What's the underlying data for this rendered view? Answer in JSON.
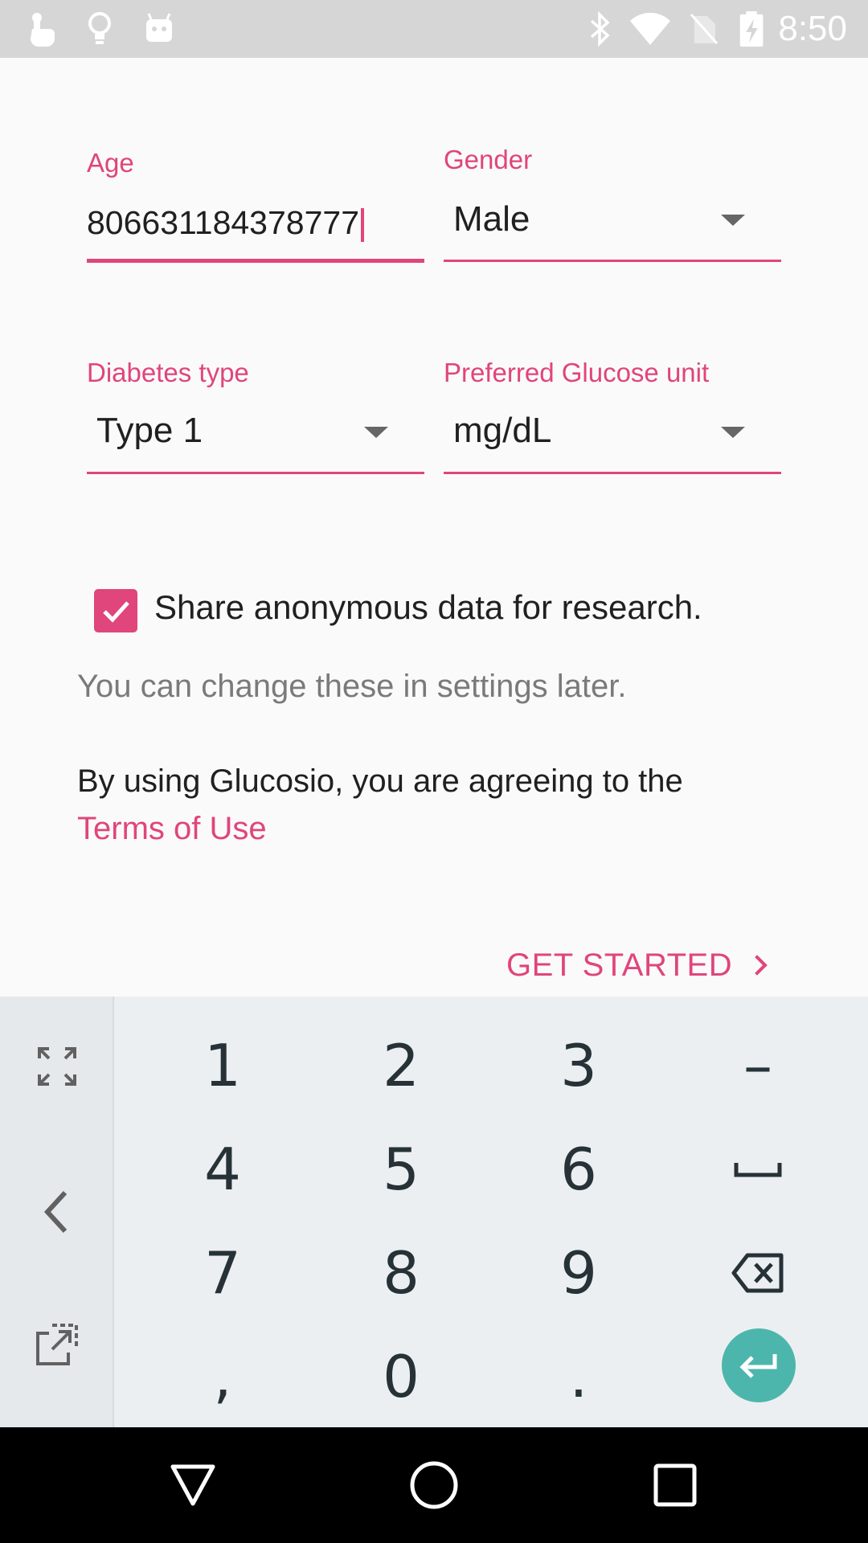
{
  "status_bar": {
    "time": "8:50",
    "left_icons": [
      "touch-icon",
      "lightbulb-icon",
      "android-icon"
    ],
    "right_icons": [
      "bluetooth-icon",
      "wifi-icon",
      "no-sim-icon",
      "battery-charging-icon"
    ]
  },
  "form": {
    "age": {
      "label": "Age",
      "value": "806631184378777"
    },
    "gender": {
      "label": "Gender",
      "value": "Male"
    },
    "diabetes_type": {
      "label": "Diabetes type",
      "value": "Type 1"
    },
    "glucose_unit": {
      "label": "Preferred Glucose unit",
      "value": "mg/dL"
    },
    "share_checkbox": {
      "label": "Share anonymous data for research.",
      "checked": true
    },
    "hint": "You can change these in settings later.",
    "terms_text": "By using Glucosio, you are agreeing to the",
    "terms_link": "Terms of Use",
    "get_started": "GET STARTED"
  },
  "keyboard": {
    "keys": [
      [
        "1",
        "2",
        "3",
        "–"
      ],
      [
        "4",
        "5",
        "6",
        "space"
      ],
      [
        "7",
        "8",
        "9",
        "backspace"
      ],
      [
        ",",
        "0",
        ".",
        "enter"
      ]
    ],
    "side_icons": [
      "fullscreen-icon",
      "back-arrow-icon",
      "popout-icon"
    ],
    "row1": {
      "k1": "1",
      "k2": "2",
      "k3": "3",
      "k4": "–"
    },
    "row2": {
      "k1": "4",
      "k2": "5",
      "k3": "6"
    },
    "row3": {
      "k1": "7",
      "k2": "8",
      "k3": "9"
    },
    "row4": {
      "k1": ",",
      "k2": "0",
      "k3": "."
    }
  },
  "colors": {
    "accent": "#e0457b",
    "enter_key": "#4db6ac",
    "status_bar": "#d6d6d6",
    "keyboard_bg": "#eceff1"
  },
  "nav_bar": {
    "icons": [
      "back-triangle-icon",
      "home-circle-icon",
      "recents-square-icon"
    ]
  }
}
